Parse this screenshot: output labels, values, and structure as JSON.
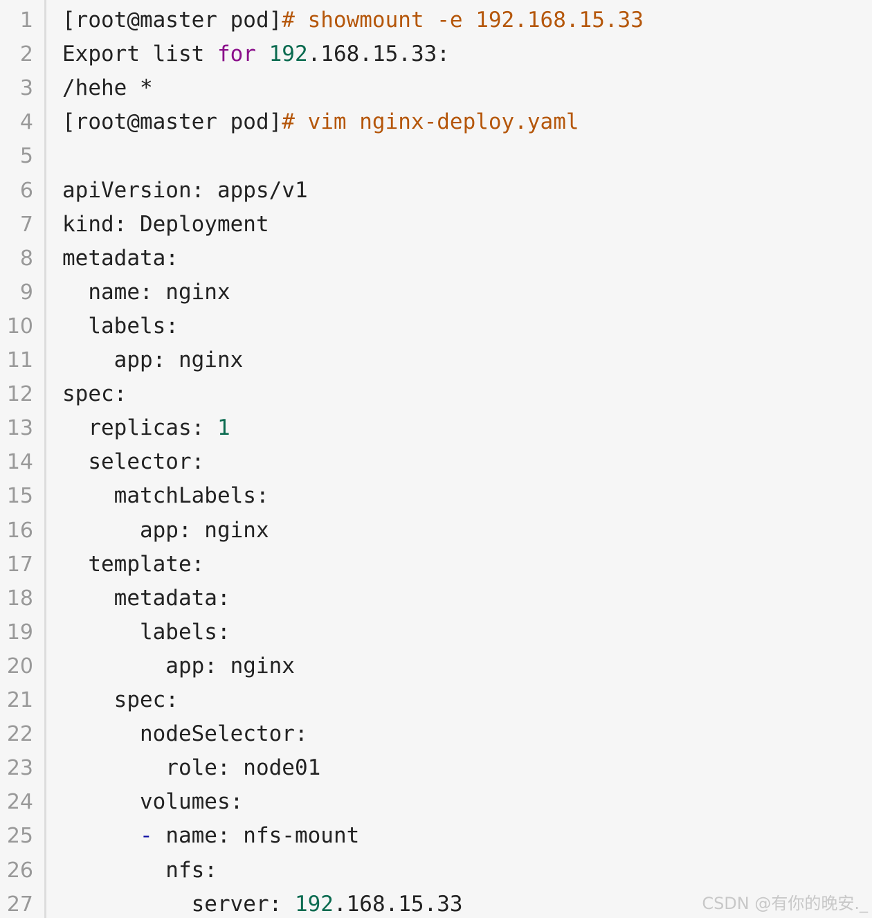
{
  "colors": {
    "background": "#f6f6f6",
    "default": "#222222",
    "command": "#b5570b",
    "keyword": "#8a0e8a",
    "number": "#0b6b50",
    "punctuation": "#1a1aa6",
    "line_number": "#999999",
    "gutter_border": "#dddddd",
    "watermark": "#c8c8c8"
  },
  "lines": [
    {
      "num": "1",
      "tokens": [
        {
          "t": "[root@master pod]",
          "c": "default"
        },
        {
          "t": "# showmount -e 192.168.15.33",
          "c": "command"
        }
      ]
    },
    {
      "num": "2",
      "tokens": [
        {
          "t": "Export list ",
          "c": "default"
        },
        {
          "t": "for",
          "c": "keyword"
        },
        {
          "t": " ",
          "c": "default"
        },
        {
          "t": "192",
          "c": "number"
        },
        {
          "t": ".168.15.33:",
          "c": "default"
        }
      ]
    },
    {
      "num": "3",
      "tokens": [
        {
          "t": "/hehe *",
          "c": "default"
        }
      ]
    },
    {
      "num": "4",
      "tokens": [
        {
          "t": "[root@master pod]",
          "c": "default"
        },
        {
          "t": "# vim nginx-deploy.yaml",
          "c": "command"
        }
      ]
    },
    {
      "num": "5",
      "tokens": []
    },
    {
      "num": "6",
      "tokens": [
        {
          "t": "apiVersion: apps/v1",
          "c": "default"
        }
      ]
    },
    {
      "num": "7",
      "tokens": [
        {
          "t": "kind: Deployment",
          "c": "default"
        }
      ]
    },
    {
      "num": "8",
      "tokens": [
        {
          "t": "metadata:",
          "c": "default"
        }
      ]
    },
    {
      "num": "9",
      "tokens": [
        {
          "t": "  name: nginx",
          "c": "default"
        }
      ]
    },
    {
      "num": "10",
      "tokens": [
        {
          "t": "  labels:",
          "c": "default"
        }
      ]
    },
    {
      "num": "11",
      "tokens": [
        {
          "t": "    app: nginx",
          "c": "default"
        }
      ]
    },
    {
      "num": "12",
      "tokens": [
        {
          "t": "spec:",
          "c": "default"
        }
      ]
    },
    {
      "num": "13",
      "tokens": [
        {
          "t": "  replicas: ",
          "c": "default"
        },
        {
          "t": "1",
          "c": "number"
        }
      ]
    },
    {
      "num": "14",
      "tokens": [
        {
          "t": "  selector:",
          "c": "default"
        }
      ]
    },
    {
      "num": "15",
      "tokens": [
        {
          "t": "    matchLabels:",
          "c": "default"
        }
      ]
    },
    {
      "num": "16",
      "tokens": [
        {
          "t": "      app: nginx",
          "c": "default"
        }
      ]
    },
    {
      "num": "17",
      "tokens": [
        {
          "t": "  template:",
          "c": "default"
        }
      ]
    },
    {
      "num": "18",
      "tokens": [
        {
          "t": "    metadata:",
          "c": "default"
        }
      ]
    },
    {
      "num": "19",
      "tokens": [
        {
          "t": "      labels:",
          "c": "default"
        }
      ]
    },
    {
      "num": "20",
      "tokens": [
        {
          "t": "        app: nginx",
          "c": "default"
        }
      ]
    },
    {
      "num": "21",
      "tokens": [
        {
          "t": "    spec:",
          "c": "default"
        }
      ]
    },
    {
      "num": "22",
      "tokens": [
        {
          "t": "      nodeSelector:",
          "c": "default"
        }
      ]
    },
    {
      "num": "23",
      "tokens": [
        {
          "t": "        role: node01",
          "c": "default"
        }
      ]
    },
    {
      "num": "24",
      "tokens": [
        {
          "t": "      volumes:",
          "c": "default"
        }
      ]
    },
    {
      "num": "25",
      "tokens": [
        {
          "t": "      ",
          "c": "default"
        },
        {
          "t": "-",
          "c": "punctuation"
        },
        {
          "t": " name: nfs-mount",
          "c": "default"
        }
      ]
    },
    {
      "num": "26",
      "tokens": [
        {
          "t": "        nfs:",
          "c": "default"
        }
      ]
    },
    {
      "num": "27",
      "tokens": [
        {
          "t": "          server: ",
          "c": "default"
        },
        {
          "t": "192",
          "c": "number"
        },
        {
          "t": ".168.15.33",
          "c": "default"
        }
      ]
    }
  ],
  "watermark": "CSDN @有你的晚安._"
}
